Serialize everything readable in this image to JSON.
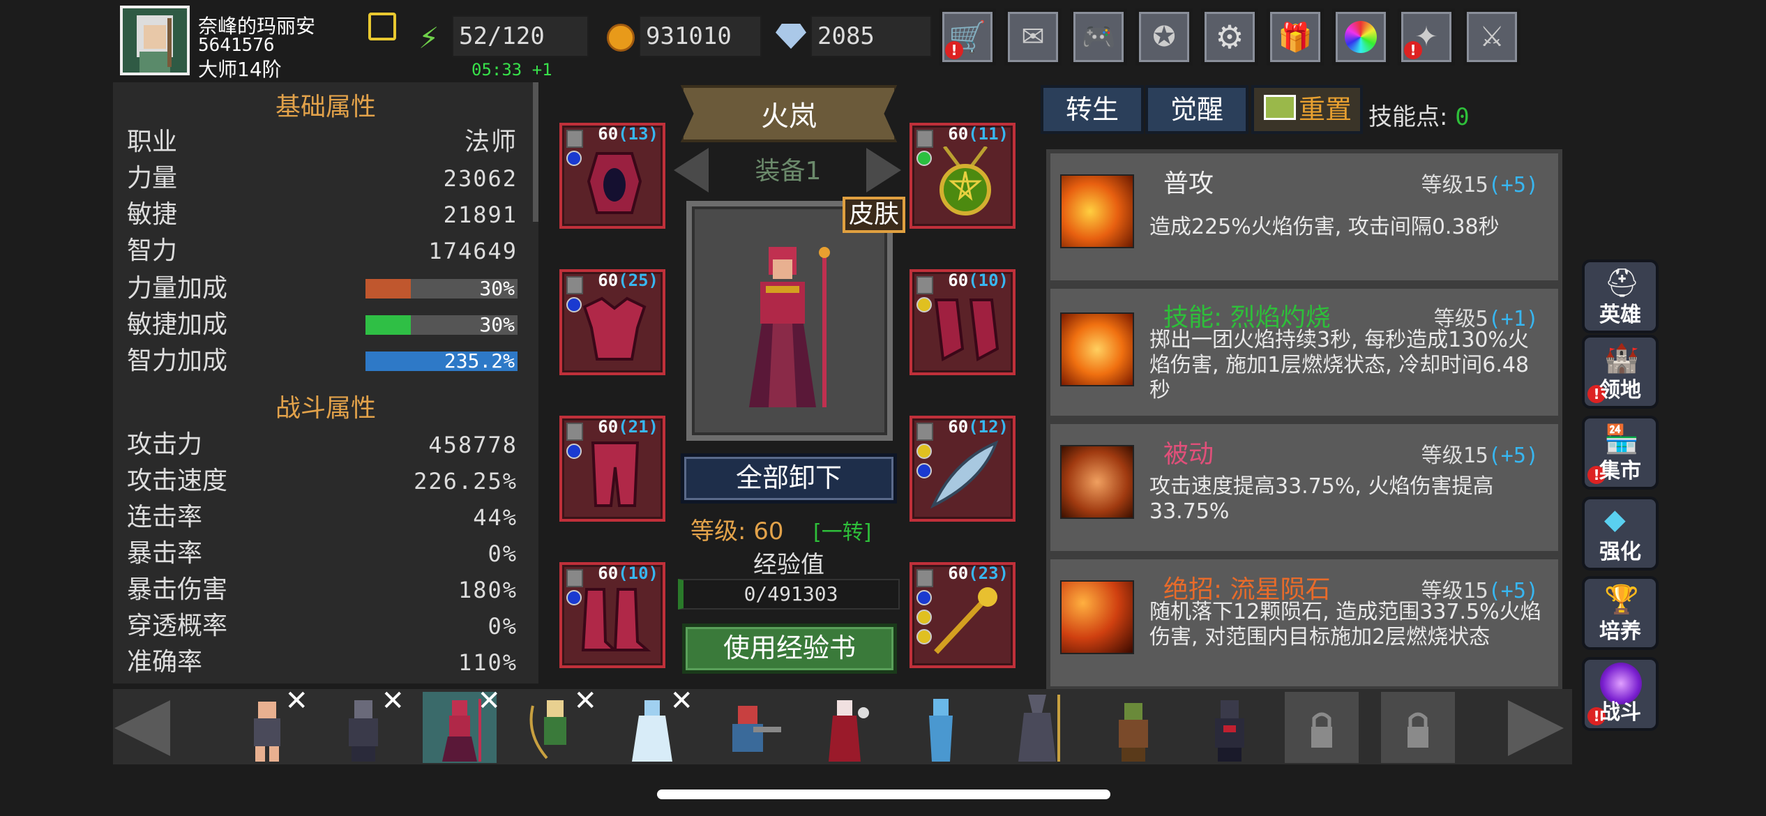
{
  "player": {
    "name": "奈峰的玛丽安",
    "id": "5641576",
    "rank": "大师14阶"
  },
  "resources": {
    "energy": "52/120",
    "energy_timer": "05:33 +1",
    "gold": "931010",
    "gems": "2085"
  },
  "top_icons": [
    "shop-icon",
    "mail-icon",
    "gamepad-icon",
    "guild-icon",
    "settings-icon",
    "gift-icon",
    "color-wheel-icon",
    "event-icon",
    "battle-swords-icon"
  ],
  "basic": {
    "title": "基础属性",
    "rows": [
      {
        "k": "职业",
        "v": "法师"
      },
      {
        "k": "力量",
        "v": "23062"
      },
      {
        "k": "敏捷",
        "v": "21891"
      },
      {
        "k": "智力",
        "v": "174649"
      }
    ],
    "bonus": [
      {
        "k": "力量加成",
        "v": "30%",
        "frac": 0.3,
        "color": "#c0572e"
      },
      {
        "k": "敏捷加成",
        "v": "30%",
        "frac": 0.3,
        "color": "#2fbf45"
      },
      {
        "k": "智力加成",
        "v": "235.2%",
        "frac": 1.0,
        "color": "#2e79c7"
      }
    ]
  },
  "combat": {
    "title": "战斗属性",
    "rows": [
      {
        "k": "攻击力",
        "v": "458778"
      },
      {
        "k": "攻击速度",
        "v": "226.25%"
      },
      {
        "k": "连击率",
        "v": "44%"
      },
      {
        "k": "暴击率",
        "v": "0%"
      },
      {
        "k": "暴击伤害",
        "v": "180%"
      },
      {
        "k": "穿透概率",
        "v": "0%"
      },
      {
        "k": "准确率",
        "v": "110%"
      }
    ]
  },
  "hero": {
    "name": "火岚",
    "equip_set": "装备1",
    "skin": "皮肤",
    "unequip_all": "全部卸下",
    "level_label": "等级: 60",
    "rebirth": "[一转]",
    "exp_label": "经验值",
    "exp": "0/491303",
    "use_exp_book": "使用经验书"
  },
  "slots": [
    {
      "lv": "60",
      "plus": "(13)"
    },
    {
      "lv": "60",
      "plus": "(11)"
    },
    {
      "lv": "60",
      "plus": "(25)"
    },
    {
      "lv": "60",
      "plus": "(10)"
    },
    {
      "lv": "60",
      "plus": "(21)"
    },
    {
      "lv": "60",
      "plus": "(12)"
    },
    {
      "lv": "60",
      "plus": "(10)"
    },
    {
      "lv": "60",
      "plus": "(23)"
    }
  ],
  "skill_tabs": {
    "rebirth": "转生",
    "awaken": "觉醒",
    "reset": "重置",
    "points_label": "技能点: ",
    "points": "0"
  },
  "skills": [
    {
      "name": "普攻",
      "name_color": "#ffffff",
      "level": "等级15",
      "bonus": "(+5)",
      "desc": "造成225%火焰伤害, 攻击间隔0.38秒"
    },
    {
      "name": "技能: 烈焰灼烧",
      "name_color": "#2ebf3a",
      "level": "等级5",
      "bonus": "(+1)",
      "desc": "掷出一团火焰持续3秒, 每秒造成130%火焰伤害, 施加1层燃烧状态, 冷却时间6.48秒"
    },
    {
      "name": "被动",
      "name_color": "#e0507a",
      "level": "等级15",
      "bonus": "(+5)",
      "desc": "攻击速度提高33.75%, 火焰伤害提高33.75%"
    },
    {
      "name": "绝招: 流星陨石",
      "name_color": "#e86b2a",
      "level": "等级15",
      "bonus": "(+5)",
      "desc": "随机落下12颗陨石, 造成范围337.5%火焰伤害, 对范围内目标施加2层燃烧状态"
    }
  ],
  "side_menu": [
    "英雄",
    "领地",
    "集市",
    "强化",
    "培养",
    "战斗"
  ],
  "colors": {
    "accent": "#e2a24a",
    "blue": "#38b6f0",
    "green": "#2ebf3a"
  }
}
